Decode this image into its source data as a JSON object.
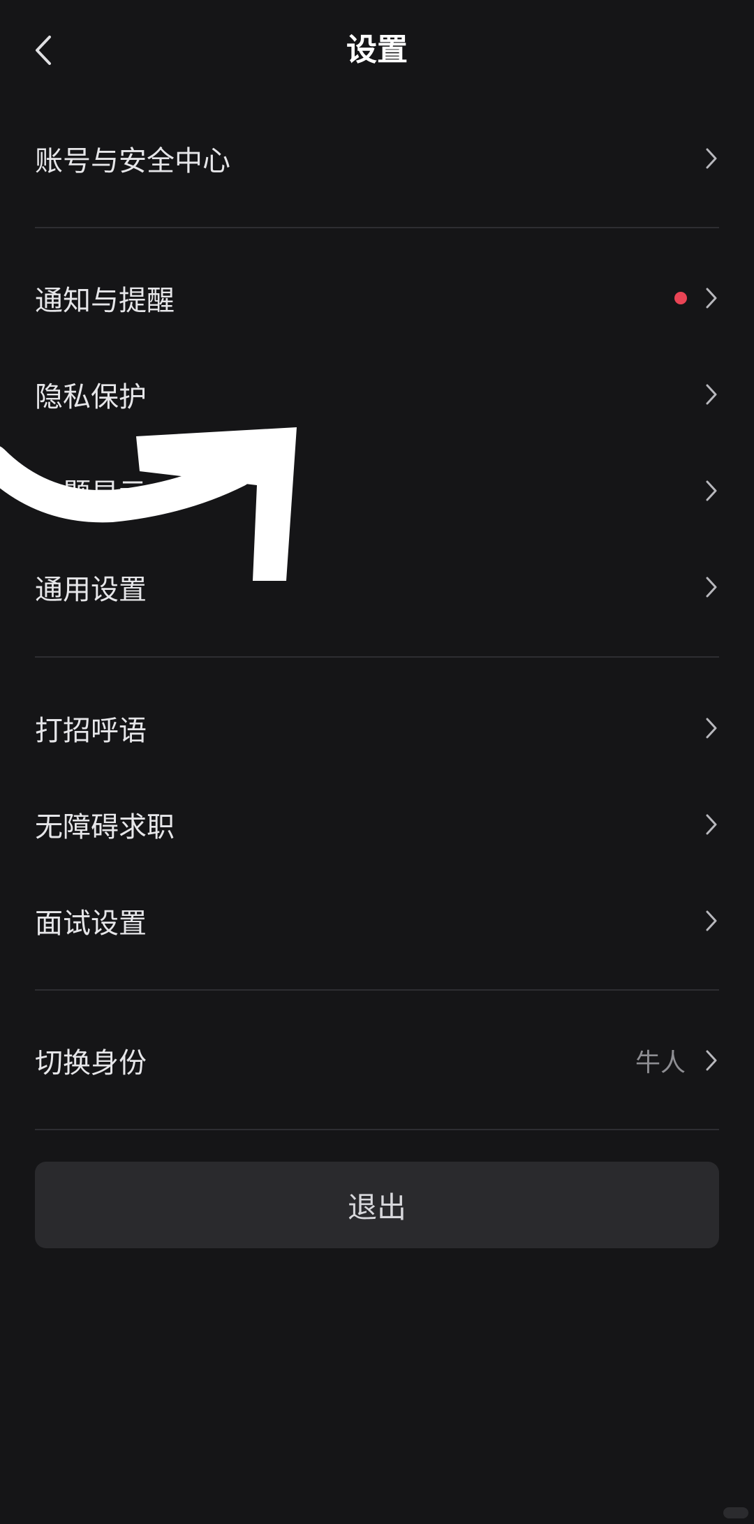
{
  "header": {
    "title": "设置",
    "back_icon": "chevron-left-icon"
  },
  "sections": [
    {
      "items": [
        {
          "label": "账号与安全中心"
        }
      ]
    },
    {
      "items": [
        {
          "label": "通知与提醒",
          "badge": "red-dot"
        },
        {
          "label": "隐私保护"
        },
        {
          "label": "主题显示"
        },
        {
          "label": "通用设置"
        }
      ]
    },
    {
      "items": [
        {
          "label": "打招呼语"
        },
        {
          "label": "无障碍求职"
        },
        {
          "label": "面试设置"
        }
      ]
    },
    {
      "items": [
        {
          "label": "切换身份",
          "value": "牛人"
        }
      ]
    }
  ],
  "logout": {
    "label": "退出"
  },
  "colors": {
    "background": "#151517",
    "badge": "#e94455",
    "button_bg": "#2a2a2d"
  }
}
